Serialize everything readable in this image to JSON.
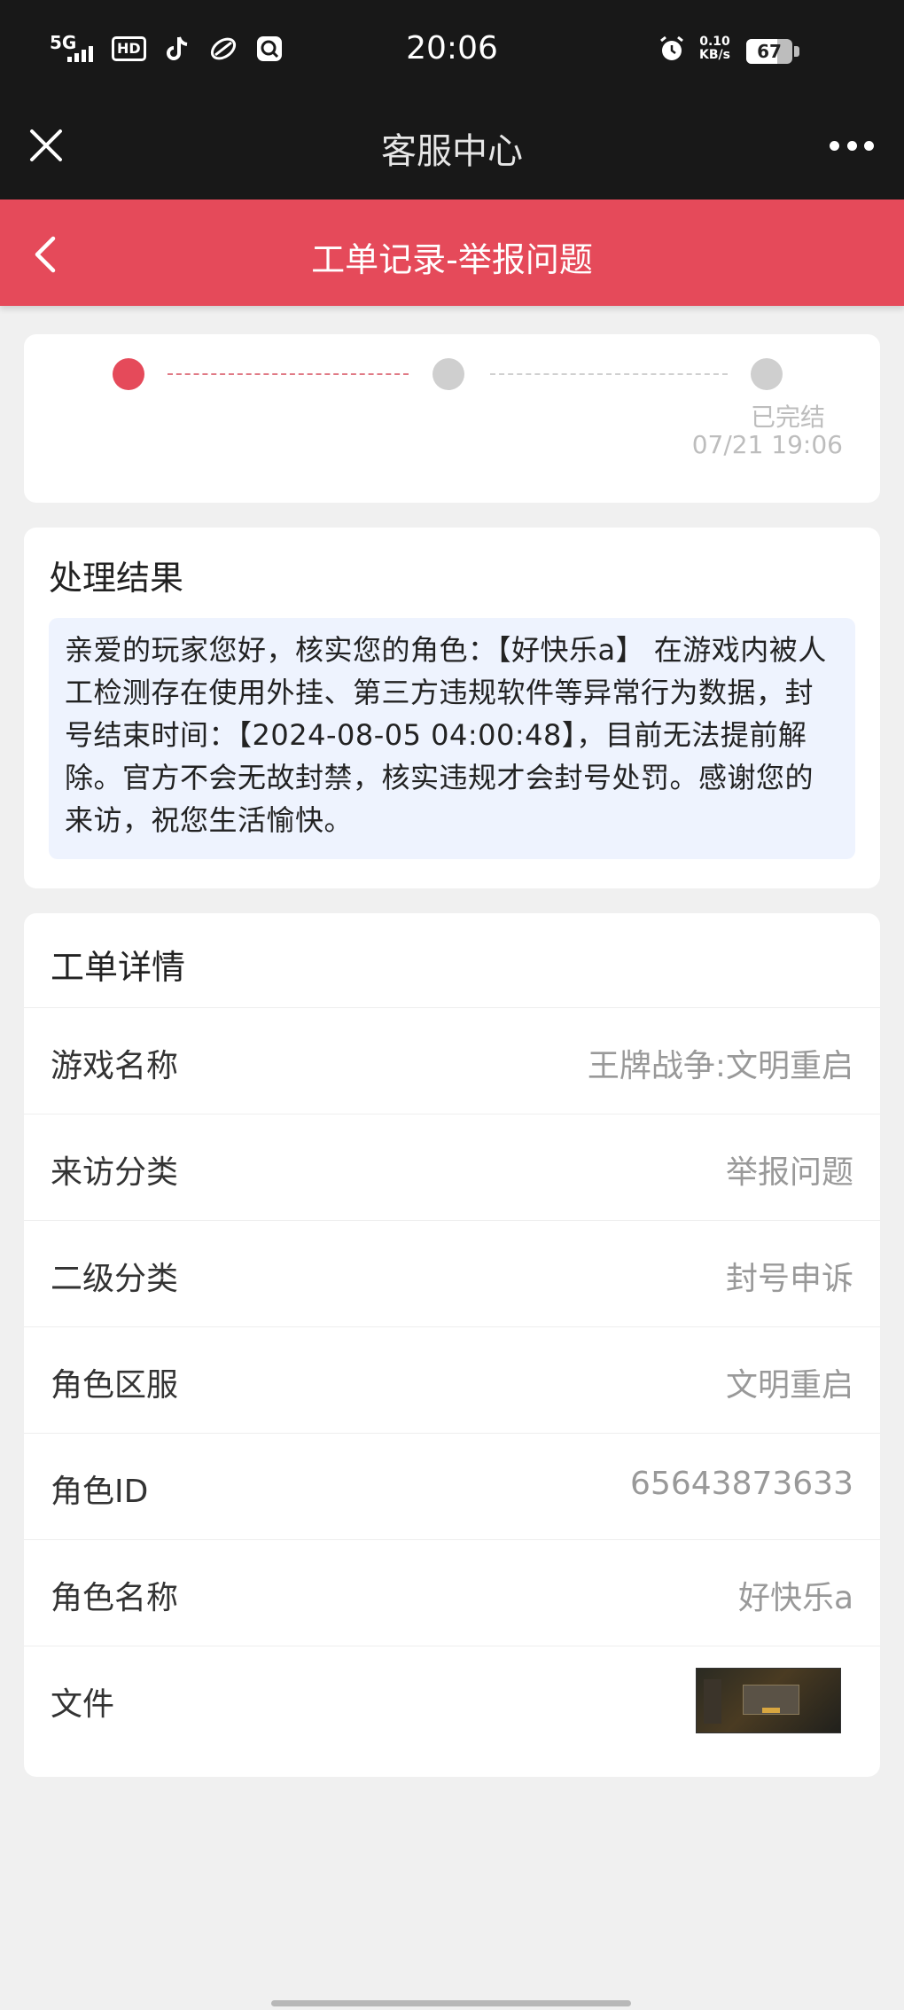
{
  "status_bar": {
    "network": "5G",
    "hd": "HD",
    "time": "20:06",
    "speed_value": "0.10",
    "speed_unit": "KB/s",
    "battery": "67"
  },
  "nav": {
    "title": "客服中心",
    "close_icon": "close-icon",
    "more_icon": "more-icon"
  },
  "header": {
    "title": "工单记录-举报问题",
    "back_icon": "chevron-left-icon",
    "color": "#e54a5a"
  },
  "progress": {
    "status": "已完结",
    "time": "07/21 19:06",
    "active_color": "#e54a5a",
    "inactive_color": "#cfcfcf"
  },
  "result": {
    "title": "处理结果",
    "body": "亲爱的玩家您好，核实您的角色：【好快乐a】 在游戏内被人工检测存在使用外挂、第三方违规软件等异常行为数据，封号结束时间：【2024-08-05 04:00:48】，目前无法提前解除。官方不会无故封禁，核实违规才会封号处罚。感谢您的来访，祝您生活愉快。"
  },
  "details": {
    "title": "工单详情",
    "rows": [
      {
        "label": "游戏名称",
        "value": "王牌战争:文明重启"
      },
      {
        "label": "来访分类",
        "value": "举报问题"
      },
      {
        "label": "二级分类",
        "value": "封号申诉"
      },
      {
        "label": "角色区服",
        "value": "文明重启"
      },
      {
        "label": "角色ID",
        "value": "65643873633"
      },
      {
        "label": "角色名称",
        "value": "好快乐a"
      },
      {
        "label": "文件",
        "value": ""
      }
    ]
  }
}
